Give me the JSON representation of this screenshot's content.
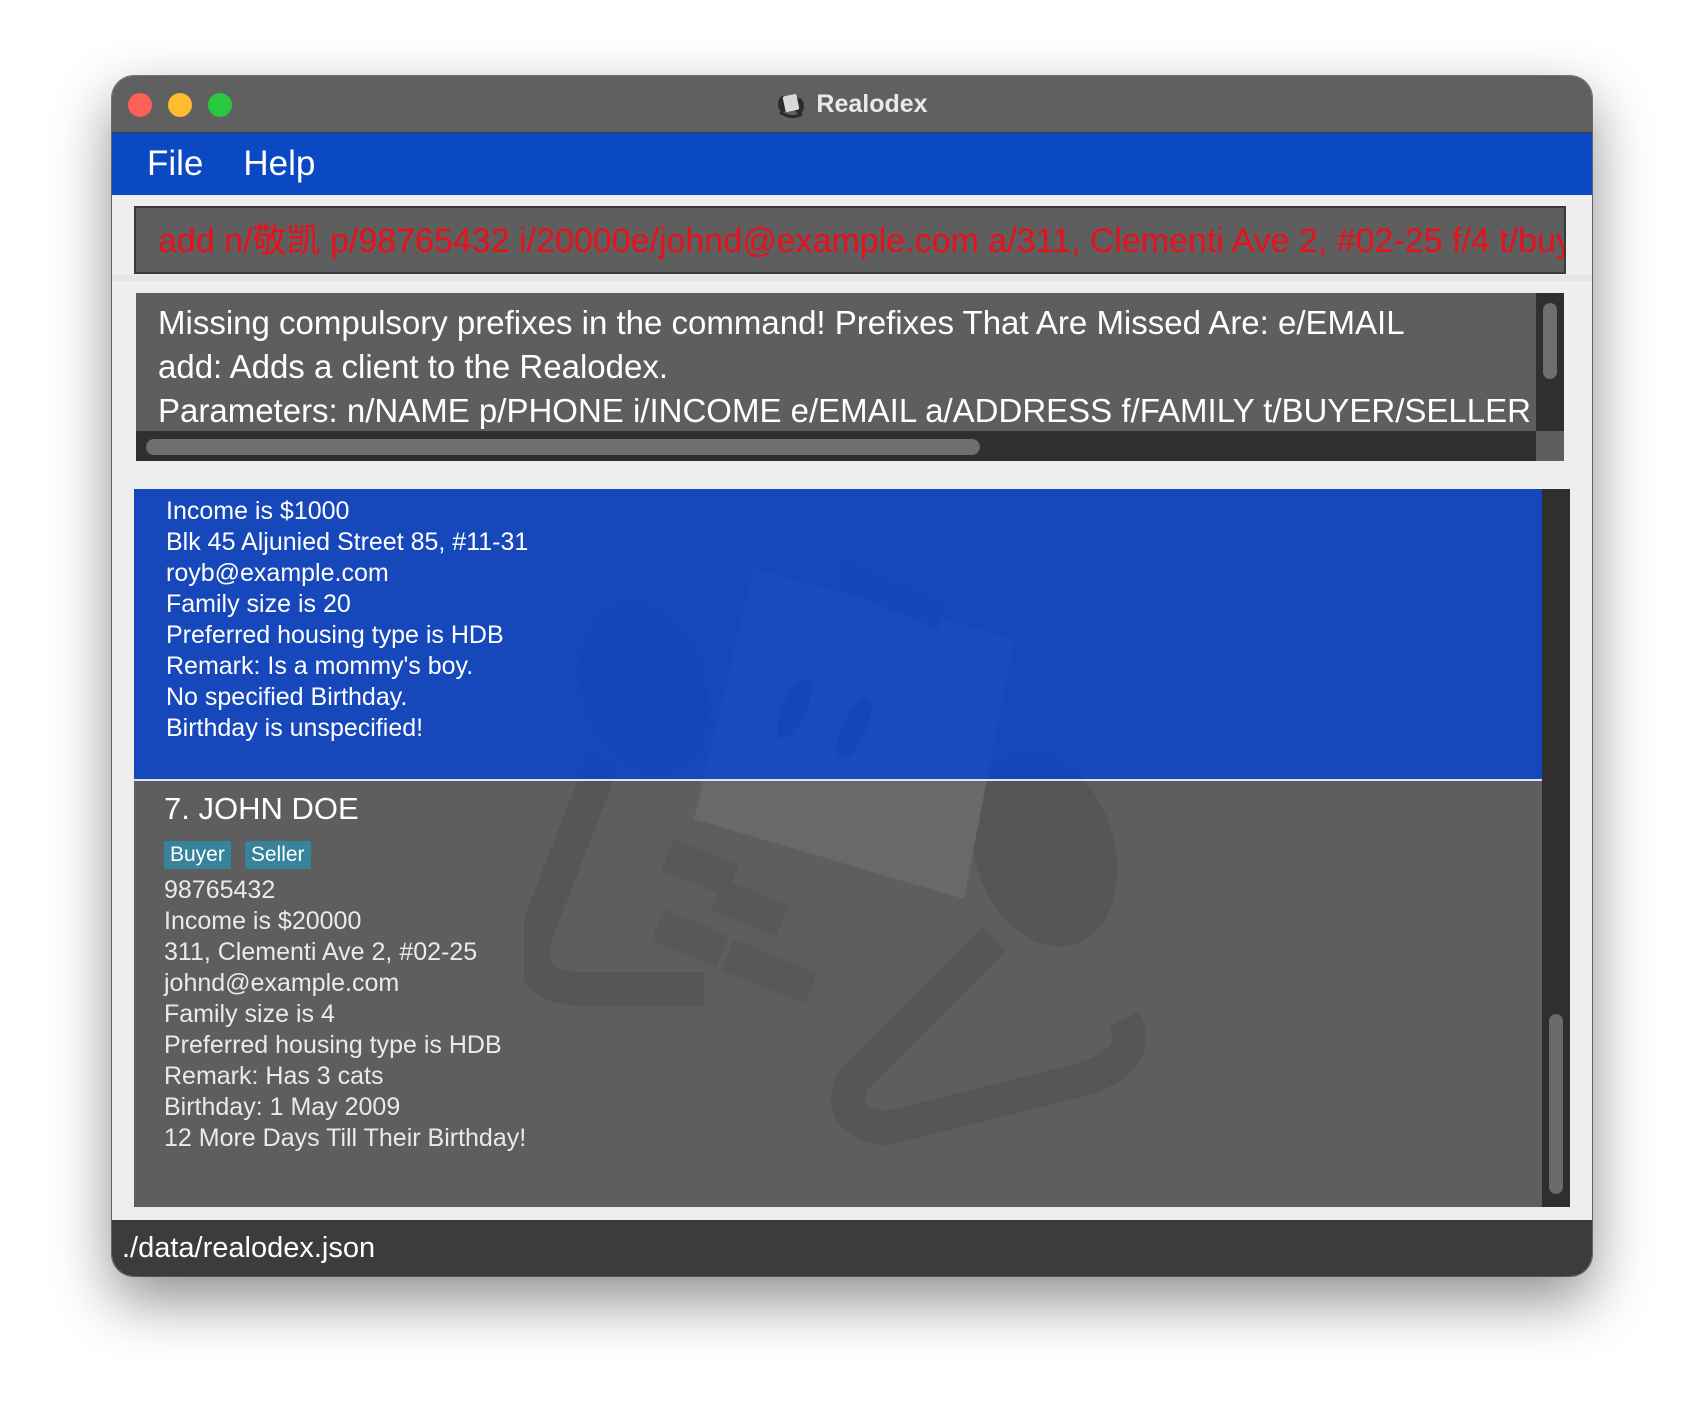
{
  "window": {
    "title": "Realodex",
    "icon": "rolodex-icon"
  },
  "menu": {
    "file": "File",
    "help": "Help"
  },
  "command_box": {
    "value": "add n/敬凯 p/98765432 i/20000e/johnd@example.com a/311, Clementi Ave 2, #02-25 f/4 t/buy",
    "text_color": "#e8101a"
  },
  "result_display": {
    "lines": [
      "Missing compulsory prefixes in the command! Prefixes That Are Missed Are: e/EMAIL",
      "add: Adds a client to the Realodex.",
      "Parameters: n/NAME p/PHONE i/INCOME e/EMAIL a/ADDRESS f/FAMILY t/BUYER/SELLER h/H"
    ]
  },
  "person_list": {
    "cards": [
      {
        "selected": true,
        "details": [
          "Income is $1000",
          "Blk 45 Aljunied Street 85, #11-31",
          "royb@example.com",
          "Family size is 20",
          "Preferred housing type is HDB",
          "Remark: Is a mommy's boy.",
          "No specified Birthday.",
          "Birthday is unspecified!"
        ]
      },
      {
        "selected": false,
        "index": "7.",
        "name": "JOHN DOE",
        "tags": [
          "Buyer",
          "Seller"
        ],
        "details": [
          "98765432",
          "Income is $20000",
          "311, Clementi Ave 2, #02-25",
          "johnd@example.com",
          "Family size is 4",
          "Preferred housing type is HDB",
          "Remark: Has 3 cats",
          "Birthday: 1 May 2009",
          "12 More Days Till Their Birthday!"
        ]
      }
    ]
  },
  "status_bar": {
    "path": "./data/realodex.json"
  },
  "colors": {
    "menu_bar": "#0b48c3",
    "selected_card": "#0e46c8",
    "tag": "#36839b",
    "panel": "#5e5e5e"
  }
}
